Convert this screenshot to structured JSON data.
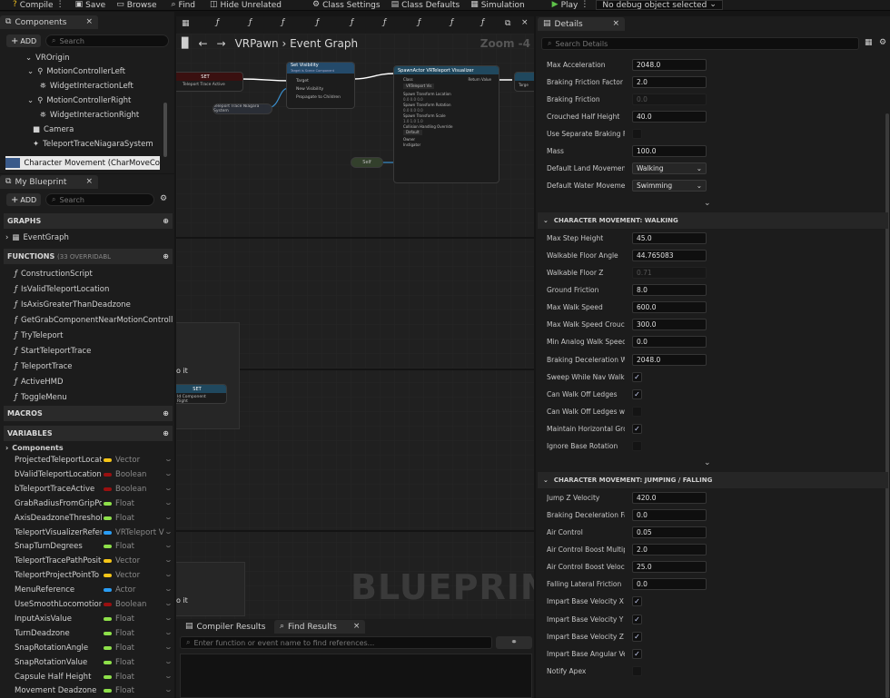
{
  "toolbar": {
    "compile": "Compile",
    "save": "Save",
    "browse": "Browse",
    "find": "Find",
    "hide_unrelated": "Hide Unrelated",
    "class_settings": "Class Settings",
    "class_defaults": "Class Defaults",
    "simulation": "Simulation",
    "play": "Play",
    "debug_select": "No debug object selected"
  },
  "components": {
    "tab": "Components",
    "add": "ADD",
    "search_placeholder": "Search",
    "items": [
      {
        "label": "VROrigin"
      },
      {
        "label": "MotionControllerLeft"
      },
      {
        "label": "WidgetInteractionLeft"
      },
      {
        "label": "MotionControllerRight"
      },
      {
        "label": "WidgetInteractionRight"
      },
      {
        "label": "Camera"
      },
      {
        "label": "TeleportTraceNiagaraSystem"
      },
      {
        "label": "Character Movement (CharMoveCo"
      }
    ]
  },
  "blueprint": {
    "tab": "My Blueprint",
    "add": "ADD",
    "search_placeholder": "Search",
    "graphs_header": "GRAPHS",
    "event_graph": "EventGraph",
    "functions_header": "FUNCTIONS",
    "functions_note": "(33 OVERRIDABL",
    "functions": [
      "ConstructionScript",
      "IsValidTeleportLocation",
      "IsAxisGreaterThanDeadzone",
      "GetGrabComponentNearMotionControlle",
      "TryTeleport",
      "StartTeleportTrace",
      "TeleportTrace",
      "ActiveHMD",
      "ToggleMenu"
    ],
    "macros_header": "MACROS",
    "variables_header": "VARIABLES",
    "components_cat": "Components",
    "variables": [
      {
        "name": "ProjectedTeleportLocati",
        "type": "Vector",
        "color": "#f5c518"
      },
      {
        "name": "bValidTeleportLocation",
        "type": "Boolean",
        "color": "#9a1010"
      },
      {
        "name": "bTeleportTraceActive",
        "type": "Boolean",
        "color": "#9a1010"
      },
      {
        "name": "GrabRadiusFromGripPo",
        "type": "Float",
        "color": "#8ee04a"
      },
      {
        "name": "AxisDeadzoneThreshol",
        "type": "Float",
        "color": "#8ee04a"
      },
      {
        "name": "TeleportVisualizerRefer",
        "type": "VRTeleport V",
        "color": "#2a9df4"
      },
      {
        "name": "SnapTurnDegrees",
        "type": "Float",
        "color": "#8ee04a"
      },
      {
        "name": "TeleportTracePathPosit",
        "type": "Vector",
        "color": "#f5c518"
      },
      {
        "name": "TeleportProjectPointTo",
        "type": "Vector",
        "color": "#f5c518"
      },
      {
        "name": "MenuReference",
        "type": "Actor",
        "color": "#2a9df4"
      },
      {
        "name": "UseSmoothLocomotion",
        "type": "Boolean",
        "color": "#9a1010"
      },
      {
        "name": "InputAxisValue",
        "type": "Float",
        "color": "#8ee04a"
      },
      {
        "name": "TurnDeadzone",
        "type": "Float",
        "color": "#8ee04a"
      },
      {
        "name": "SnapRotationAngle",
        "type": "Float",
        "color": "#8ee04a"
      },
      {
        "name": "SnapRotationValue",
        "type": "Float",
        "color": "#8ee04a"
      },
      {
        "name": "Capsule Half Height",
        "type": "Float",
        "color": "#8ee04a"
      },
      {
        "name": "Movement Deadzone",
        "type": "Float",
        "color": "#8ee04a"
      }
    ]
  },
  "graph": {
    "tab_label": "VRPawn",
    "graph_name": "Event Graph",
    "zoom": "Zoom -4",
    "watermark": "BLUEPRINT",
    "comment_1": "o it",
    "comment_2": "o it",
    "nodes": {
      "set1": {
        "title": "SET",
        "pin": "Teleport Trace Active"
      },
      "set_visibility": {
        "title": "Set Visibility",
        "subtitle": "Target is Scene Component",
        "pins": [
          "Target",
          "New Visibility",
          "Propagate to Children"
        ]
      },
      "teleport_var": "Teleport Trace Niagara System",
      "spawn": {
        "title": "SpawnActor VRTeleport Visualizer",
        "class": "Class",
        "class_value": "VRTeleport Vis",
        "return": "Return Value",
        "loc": "Spawn Transform Location",
        "rot": "Spawn Transform Rotation",
        "scale": "Spawn Transform Scale",
        "collision": "Collision Handling Override",
        "collision_value": "Default",
        "owner": "Owner",
        "instigator": "Instigator",
        "zero": "0.0",
        "one": "1.0"
      },
      "self": "Self",
      "set2": {
        "title": "SET",
        "pin": "Id Component Right"
      },
      "target_pin": "Targe"
    }
  },
  "bottom": {
    "compiler_tab": "Compiler Results",
    "find_tab": "Find Results",
    "find_placeholder": "Enter function or event name to find references..."
  },
  "details": {
    "tab": "Details",
    "search_placeholder": "Search Details",
    "rows_top": [
      {
        "label": "Max Acceleration",
        "kind": "num",
        "value": "2048.0"
      },
      {
        "label": "Braking Friction Factor",
        "kind": "num",
        "value": "2.0"
      },
      {
        "label": "Braking Friction",
        "kind": "disabled",
        "value": "0.0"
      },
      {
        "label": "Crouched Half Height",
        "kind": "num",
        "value": "40.0"
      },
      {
        "label": "Use Separate Braking Frict",
        "kind": "check",
        "checked": false
      },
      {
        "label": "Mass",
        "kind": "num",
        "value": "100.0"
      },
      {
        "label": "Default Land Movement Mo",
        "kind": "drop",
        "value": "Walking"
      },
      {
        "label": "Default Water Movement M",
        "kind": "drop",
        "value": "Swimming"
      }
    ],
    "section_walking": "CHARACTER MOVEMENT: WALKING",
    "rows_walking": [
      {
        "label": "Max Step Height",
        "kind": "num",
        "value": "45.0"
      },
      {
        "label": "Walkable Floor Angle",
        "kind": "num",
        "value": "44.765083"
      },
      {
        "label": "Walkable Floor Z",
        "kind": "disabled",
        "value": "0.71"
      },
      {
        "label": "Ground Friction",
        "kind": "num",
        "value": "8.0"
      },
      {
        "label": "Max Walk Speed",
        "kind": "num",
        "value": "600.0"
      },
      {
        "label": "Max Walk Speed Crouched",
        "kind": "num",
        "value": "300.0"
      },
      {
        "label": "Min Analog Walk Speed",
        "kind": "num",
        "value": "0.0"
      },
      {
        "label": "Braking Deceleration Walki",
        "kind": "num",
        "value": "2048.0"
      },
      {
        "label": "Sweep While Nav Walking",
        "kind": "check",
        "checked": true
      },
      {
        "label": "Can Walk Off Ledges",
        "kind": "check",
        "checked": true
      },
      {
        "label": "Can Walk Off Ledges when",
        "kind": "check",
        "checked": false
      },
      {
        "label": "Maintain Horizontal Groun",
        "kind": "check",
        "checked": true
      },
      {
        "label": "Ignore Base Rotation",
        "kind": "check",
        "checked": false
      }
    ],
    "section_jumping": "CHARACTER MOVEMENT: JUMPING / FALLING",
    "rows_jumping": [
      {
        "label": "Jump Z Velocity",
        "kind": "num",
        "value": "420.0"
      },
      {
        "label": "Braking Deceleration Fallin",
        "kind": "num",
        "value": "0.0"
      },
      {
        "label": "Air Control",
        "kind": "num",
        "value": "0.05"
      },
      {
        "label": "Air Control Boost Multiplier",
        "kind": "num",
        "value": "2.0"
      },
      {
        "label": "Air Control Boost Velocity T",
        "kind": "num",
        "value": "25.0"
      },
      {
        "label": "Falling Lateral Friction",
        "kind": "num",
        "value": "0.0"
      },
      {
        "label": "Impart Base Velocity X",
        "kind": "check",
        "checked": true
      },
      {
        "label": "Impart Base Velocity Y",
        "kind": "check",
        "checked": true
      },
      {
        "label": "Impart Base Velocity Z",
        "kind": "check",
        "checked": true
      },
      {
        "label": "Impart Base Angular Veloc",
        "kind": "check",
        "checked": true
      },
      {
        "label": "Notify Apex",
        "kind": "check",
        "checked": false
      }
    ]
  }
}
